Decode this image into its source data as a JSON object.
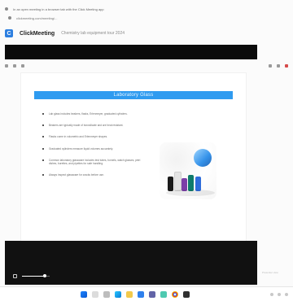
{
  "top": {
    "line1": "In an open meeting in a browser tab with the Click Meeting app",
    "line2": "clickmeeting.com/meeting/..."
  },
  "clickmeeting": {
    "brand": "ClickMeeting",
    "title": "Chemistry lab equipment tour 2024"
  },
  "slide": {
    "title": "Laboratory Glass",
    "bullets": [
      "Lab glass includes beakers, flasks, Erlenmeyer, graduated cylinders.",
      "Beakers are typically made of borosilicate and are heat resistant.",
      "Flasks come in volumetric and Erlenmeyer shapes.",
      "Graduated cylinders measure liquid volumes accurately.",
      "Common laboratory glassware includes test tubes, funnels, watch glasses, petri dishes, burettes, and pipettes for safe handling.",
      "Always inspect glassware for cracks before use."
    ]
  },
  "video": {
    "volume_fraction": 0.82,
    "side_note": "Presenter view"
  },
  "colors": {
    "slide_title_bg": "#2f9bf0",
    "black": "#0b0b0b"
  },
  "icons": {
    "taskbar": [
      "windows-start-icon",
      "search-icon",
      "task-view-icon",
      "edge-icon",
      "file-explorer-icon",
      "mail-icon",
      "teams-icon",
      "photos-icon",
      "chrome-icon",
      "terminal-icon"
    ]
  }
}
